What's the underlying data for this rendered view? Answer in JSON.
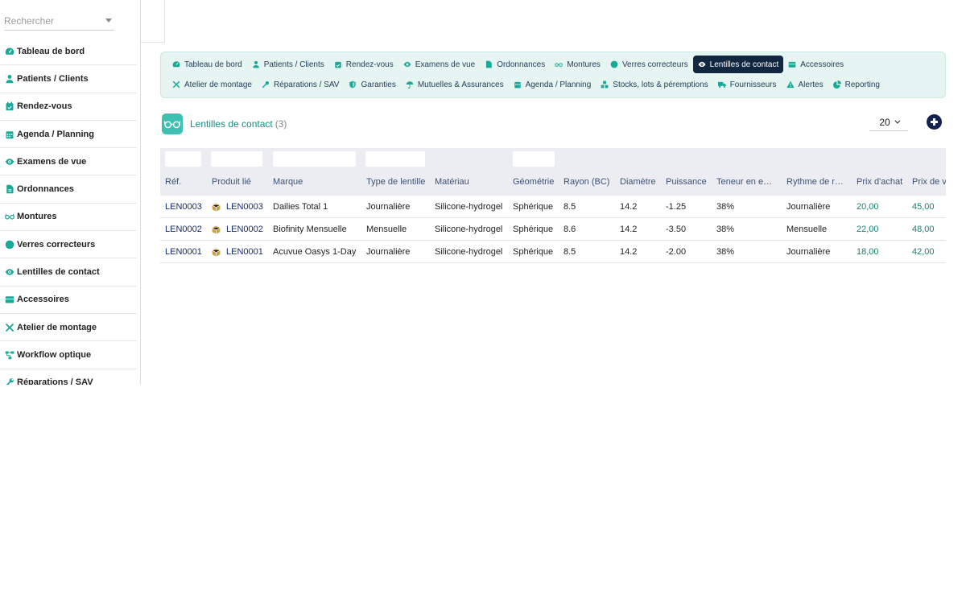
{
  "sidebar": {
    "search_placeholder": "Rechercher",
    "items": [
      {
        "label": "Tableau de bord",
        "icon": "gauge-icon"
      },
      {
        "label": "Patients / Clients",
        "icon": "user-icon"
      },
      {
        "label": "Rendez-vous",
        "icon": "calendar-check-icon"
      },
      {
        "label": "Agenda / Planning",
        "icon": "calendar-icon"
      },
      {
        "label": "Examens de vue",
        "icon": "eye-icon"
      },
      {
        "label": "Ordonnances",
        "icon": "file-icon"
      },
      {
        "label": "Montures",
        "icon": "glasses-icon"
      },
      {
        "label": "Verres correcteurs",
        "icon": "circle-icon"
      },
      {
        "label": "Lentilles de contact",
        "icon": "eye-icon"
      },
      {
        "label": "Accessoires",
        "icon": "box-icon"
      },
      {
        "label": "Atelier de montage",
        "icon": "tools-icon"
      },
      {
        "label": "Workflow optique",
        "icon": "workflow-icon"
      },
      {
        "label": "Réparations / SAV",
        "icon": "wrench-icon"
      }
    ]
  },
  "nav": {
    "row1": [
      {
        "label": "Tableau de bord",
        "icon": "gauge-icon"
      },
      {
        "label": "Patients / Clients",
        "icon": "user-icon"
      },
      {
        "label": "Rendez-vous",
        "icon": "calendar-check-icon"
      },
      {
        "label": "Examens de vue",
        "icon": "eye-icon"
      },
      {
        "label": "Ordonnances",
        "icon": "file-icon"
      },
      {
        "label": "Montures",
        "icon": "glasses-icon"
      },
      {
        "label": "Verres correcteurs",
        "icon": "circle-icon"
      },
      {
        "label": "Lentilles de contact",
        "icon": "eye-icon",
        "active": true
      },
      {
        "label": "Accessoires",
        "icon": "box-icon"
      }
    ],
    "row2": [
      {
        "label": "Atelier de montage",
        "icon": "tools-icon"
      },
      {
        "label": "Réparations / SAV",
        "icon": "wrench-icon"
      },
      {
        "label": "Garanties",
        "icon": "shield-icon"
      },
      {
        "label": "Mutuelles & Assurances",
        "icon": "umbrella-icon"
      },
      {
        "label": "Agenda / Planning",
        "icon": "calendar-icon"
      },
      {
        "label": "Stocks, lots & péremptions",
        "icon": "boxes-icon"
      },
      {
        "label": "Fournisseurs",
        "icon": "truck-icon"
      },
      {
        "label": "Alertes",
        "icon": "warning-icon"
      },
      {
        "label": "Reporting",
        "icon": "pie-chart-icon"
      }
    ]
  },
  "page": {
    "title": "Lentilles de contact",
    "count": "(3)",
    "per_page": "20"
  },
  "table": {
    "headers": [
      "Réf.",
      "Produit lié",
      "Marque",
      "Type de lentille",
      "Matériau",
      "Géométrie",
      "Rayon (BC)",
      "Diamètre",
      "Puissance",
      "Teneur en e…",
      "Rythme de r…",
      "Prix d'achat",
      "Prix de v"
    ],
    "rows": [
      [
        "LEN0003",
        "LEN0003",
        "Dailies Total 1",
        "Journalière",
        "Silicone-hydrogel",
        "Sphérique",
        "8.5",
        "14.2",
        "-1.25",
        "38%",
        "Journalière",
        "20,00",
        "45,00"
      ],
      [
        "LEN0002",
        "LEN0002",
        "Biofinity Mensuelle",
        "Mensuelle",
        "Silicone-hydrogel",
        "Sphérique",
        "8.6",
        "14.2",
        "-3.50",
        "38%",
        "Mensuelle",
        "22,00",
        "48,00"
      ],
      [
        "LEN0001",
        "LEN0001",
        "Acuvue Oasys 1-Day",
        "Journalière",
        "Silicone-hydrogel",
        "Sphérique",
        "8.5",
        "14.2",
        "-2.00",
        "38%",
        "Journalière",
        "18,00",
        "42,00"
      ]
    ]
  },
  "colors": {
    "accent": "#3dbfb2",
    "active_nav": "#10273f",
    "link": "#162b6e"
  }
}
